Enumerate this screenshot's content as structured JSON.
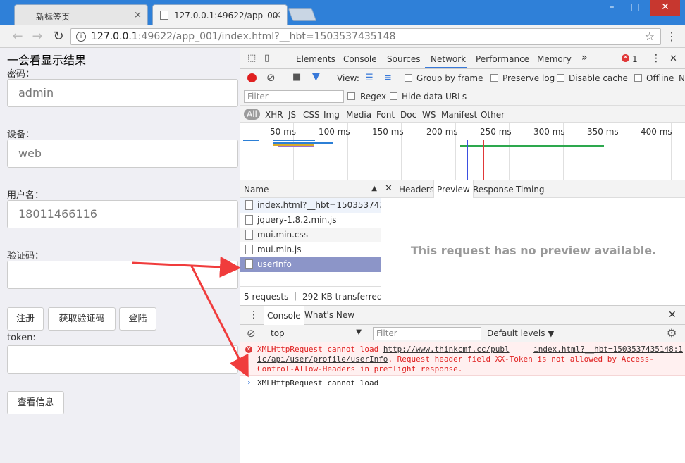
{
  "browser": {
    "tabs": [
      {
        "label": "新标签页",
        "close": "×"
      },
      {
        "label": "127.0.0.1:49622/app_00",
        "close": "×"
      }
    ],
    "window_controls": {
      "min": "–",
      "max": "□",
      "close": "✕"
    },
    "nav": {
      "back": "←",
      "forward": "→",
      "reload": "↻"
    },
    "url_host": "127.0.0.1",
    "url_rest": ":49622/app_001/index.html?__hbt=1503537435148",
    "star": "☆",
    "menu": "⋮"
  },
  "page": {
    "result_text": "一会看显示结果",
    "fields": [
      {
        "label": "密码：",
        "value": "admin"
      },
      {
        "label": "设备：",
        "value": "web"
      },
      {
        "label": "用户名：",
        "value": "18011466116"
      },
      {
        "label": "验证码：",
        "value": ""
      }
    ],
    "buttons": {
      "register": "注册",
      "get_code": "获取验证码",
      "login": "登陆"
    },
    "token_label": "token:",
    "token_value": "",
    "view_info": "查看信息"
  },
  "devtools": {
    "tabs": [
      "Elements",
      "Console",
      "Sources",
      "Network",
      "Performance",
      "Memory"
    ],
    "more": "»",
    "error_count": "1",
    "error_icon": "✕",
    "close": "✕",
    "menu": "⋮",
    "network_toolbar": {
      "view_label": "View:",
      "group_by_frame": "Group by frame",
      "preserve_log": "Preserve log",
      "disable_cache": "Disable cache",
      "offline": "Offline",
      "truncated": "N"
    },
    "filter": {
      "placeholder": "Filter",
      "regex": "Regex",
      "hide_data_urls": "Hide data URLs"
    },
    "types": [
      "All",
      "XHR",
      "JS",
      "CSS",
      "Img",
      "Media",
      "Font",
      "Doc",
      "WS",
      "Manifest",
      "Other"
    ],
    "timeline_ticks": [
      "50 ms",
      "100 ms",
      "150 ms",
      "200 ms",
      "250 ms",
      "300 ms",
      "350 ms",
      "400 ms"
    ],
    "list_header": "Name",
    "sort_icon": "▲",
    "requests": [
      {
        "name": "index.html?__hbt=1503537435...",
        "selected": false
      },
      {
        "name": "jquery-1.8.2.min.js",
        "selected": false
      },
      {
        "name": "mui.min.css",
        "selected": false
      },
      {
        "name": "mui.min.js",
        "selected": false
      },
      {
        "name": "userInfo",
        "selected": true
      }
    ],
    "summary": "5 requests ｜ 292 KB transferred ｜ ...",
    "detail_close": "✕",
    "detail_tabs": [
      "Headers",
      "Preview",
      "Response",
      "Timing"
    ],
    "no_preview": "This request has no preview available.",
    "drawer": {
      "menu": "⋮",
      "tabs": [
        "Console",
        "What's New"
      ],
      "close": "✕",
      "context": "top",
      "context_arrow": "▼",
      "filter_placeholder": "Filter",
      "levels": "Default levels ▼",
      "gear": "⚙",
      "clear": "⊘",
      "error_line1": "XMLHttpRequest cannot load ",
      "error_link": "http://www.thinkcmf.cc/publ",
      "error_line2": "ic/api/user/profile/userInfo",
      "error_line2_rest": ". Request header field XX-Token is not allowed by Access-",
      "error_line3": "Control-Allow-Headers in preflight response.",
      "error_source": "index.html?__hbt=1503537435148:1",
      "prompt_text": "XMLHttpRequest cannot load",
      "prompt_chevron": "›"
    }
  },
  "colors": {
    "accent": "#3879d9",
    "error": "#e03838",
    "arrow": "#f03c3c",
    "selected_row": "#8c95c8",
    "titlebar": "#2f80d8"
  }
}
